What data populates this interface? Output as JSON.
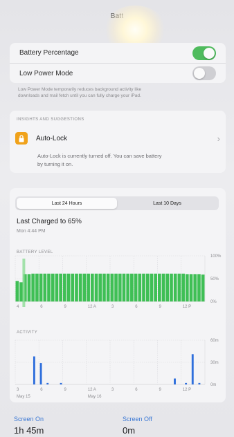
{
  "nav": {
    "title": "Batt"
  },
  "settings": {
    "battery_percentage_label": "Battery Percentage",
    "battery_percentage_on": true,
    "low_power_label": "Low Power Mode",
    "low_power_on": false,
    "low_power_note_line1": "Low Power Mode temporarily reduces background activity like",
    "low_power_note_line2": "downloads and mail fetch until you can fully charge your iPad."
  },
  "insights": {
    "header": "INSIGHTS AND SUGGESTIONS",
    "autolock_label": "Auto-Lock",
    "chevron": "›",
    "autolock_note_line1": "Auto-Lock is currently turned off. You can save battery",
    "autolock_note_line2": "by turning it on."
  },
  "segment": {
    "tab1": "Last 24 Hours",
    "tab2": "Last 10 Days",
    "active": 0
  },
  "last_charged": {
    "title": "Last Charged to 65%",
    "time": "Mon 4:44 PM"
  },
  "battery_chart": {
    "header": "BATTERY LEVEL",
    "y_labels": [
      "100%",
      "50%",
      "0%"
    ],
    "x_labels": [
      "4",
      "6",
      "9",
      "12 A",
      "3",
      "6",
      "9",
      "12 P"
    ],
    "accent": "#3fbf55"
  },
  "activity_chart": {
    "header": "ACTIVITY",
    "y_labels": [
      "60m",
      "30m",
      "0m"
    ],
    "x_labels": [
      "3",
      "6",
      "9",
      "12 A",
      "3",
      "6",
      "9",
      "12 P"
    ],
    "date_labels": [
      "May 15",
      "May 16"
    ],
    "accent": "#2f6fdc"
  },
  "chart_data": [
    {
      "type": "bar",
      "title": "BATTERY LEVEL",
      "ylim": [
        0,
        100
      ],
      "y_ticks": [
        "0%",
        "50%",
        "100%"
      ],
      "x_ticks": [
        "4",
        "6",
        "9",
        "12 A",
        "3",
        "6",
        "9",
        "12 P"
      ],
      "values": [
        45,
        42,
        60,
        60,
        61,
        61,
        61,
        61,
        61,
        61,
        61,
        61,
        61,
        61,
        61,
        61,
        61,
        61,
        61,
        61,
        61,
        61,
        61,
        61,
        61,
        61,
        61,
        61,
        61,
        61,
        61,
        61,
        61,
        61,
        61,
        61,
        61,
        61,
        61,
        61,
        61,
        61,
        61,
        60,
        60,
        60,
        60,
        59
      ]
    },
    {
      "type": "bar",
      "title": "ACTIVITY",
      "ylim": [
        0,
        60
      ],
      "y_ticks": [
        "0m",
        "30m",
        "60m"
      ],
      "x_ticks": [
        "3",
        "6",
        "9",
        "12 A",
        "3",
        "6",
        "9",
        "12 P"
      ],
      "values": [
        0,
        0,
        0,
        0,
        0,
        0,
        0,
        0,
        38,
        0,
        0,
        29,
        0,
        0,
        2,
        0,
        0,
        0,
        0,
        0,
        2,
        0,
        0,
        0,
        0,
        0,
        0,
        0,
        0,
        0,
        0,
        0,
        0,
        0,
        0,
        0,
        0,
        0,
        0,
        0,
        0,
        0,
        0,
        0,
        0,
        0,
        0,
        0,
        0,
        0,
        0,
        0,
        0,
        0,
        0,
        0,
        0,
        0,
        0,
        0,
        0,
        0,
        0,
        0,
        0,
        0,
        0,
        0,
        0,
        0,
        0,
        8,
        0,
        0,
        0,
        0,
        2,
        0,
        0,
        41,
        0,
        0,
        2,
        0,
        0
      ]
    }
  ],
  "usage": {
    "screen_on_label": "Screen On",
    "screen_on_value": "1h 45m",
    "screen_off_label": "Screen Off",
    "screen_off_value": "0m"
  }
}
